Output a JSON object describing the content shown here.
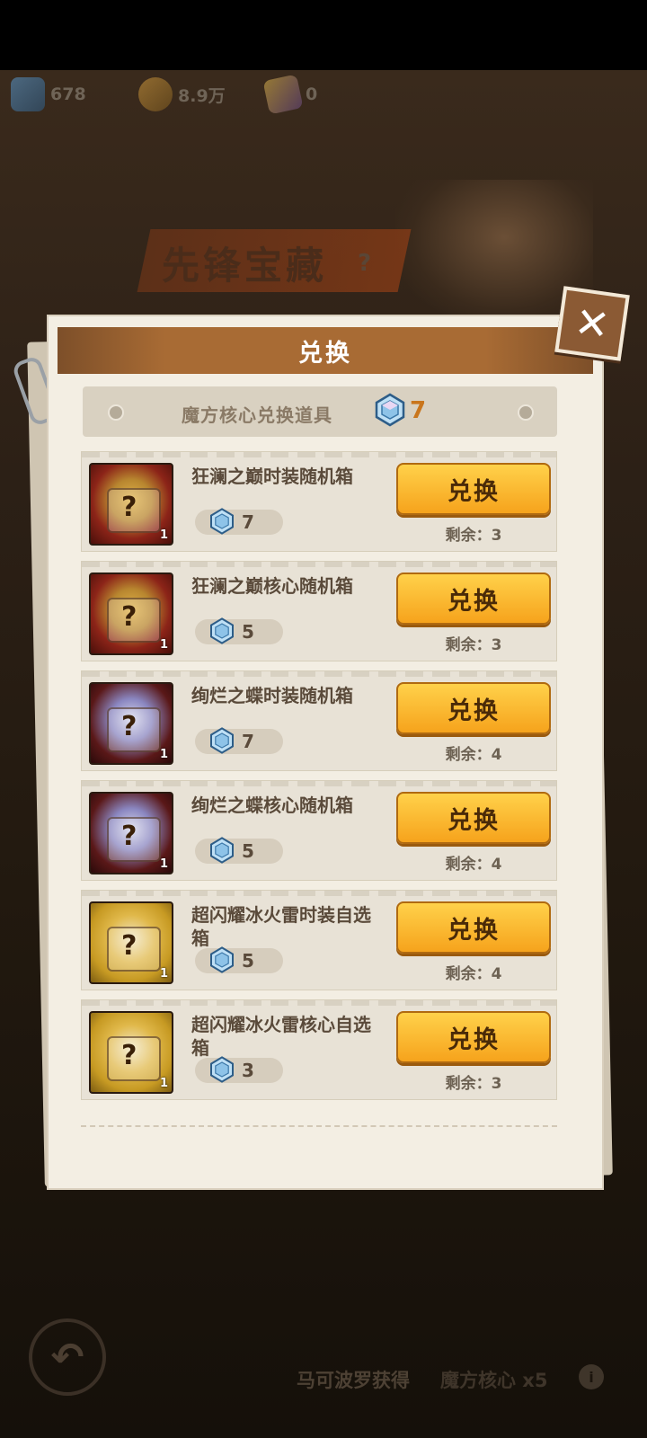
{
  "resources": [
    {
      "name": "gem",
      "value": "678"
    },
    {
      "name": "coin",
      "value": "8.9万"
    },
    {
      "name": "card",
      "value": "0"
    }
  ],
  "banner": {
    "title": "先锋宝藏",
    "help": "?"
  },
  "modal": {
    "title": "兑换",
    "close_icon": "close-icon",
    "currency": {
      "label": "魔方核心兑换道具",
      "count": "7",
      "icon": "cube-core-icon"
    }
  },
  "items": [
    {
      "name": "狂澜之巅时装随机箱",
      "cost": "7",
      "button": "兑换",
      "remaining": "剩余：3",
      "qty": "1"
    },
    {
      "name": "狂澜之巅核心随机箱",
      "cost": "5",
      "button": "兑换",
      "remaining": "剩余：3",
      "qty": "1"
    },
    {
      "name": "绚烂之蝶时装随机箱",
      "cost": "7",
      "button": "兑换",
      "remaining": "剩余：4",
      "qty": "1"
    },
    {
      "name": "绚烂之蝶核心随机箱",
      "cost": "5",
      "button": "兑换",
      "remaining": "剩余：4",
      "qty": "1"
    },
    {
      "name": "超闪耀冰火雷时装自选箱",
      "cost": "5",
      "button": "兑换",
      "remaining": "剩余：4",
      "qty": "1"
    },
    {
      "name": "超闪耀冰火雷核心自选箱",
      "cost": "3",
      "button": "兑换",
      "remaining": "剩余：3",
      "qty": "1"
    }
  ],
  "bottom": {
    "text": "马可波罗获得",
    "item": "魔方核心 x5",
    "info": "i"
  }
}
